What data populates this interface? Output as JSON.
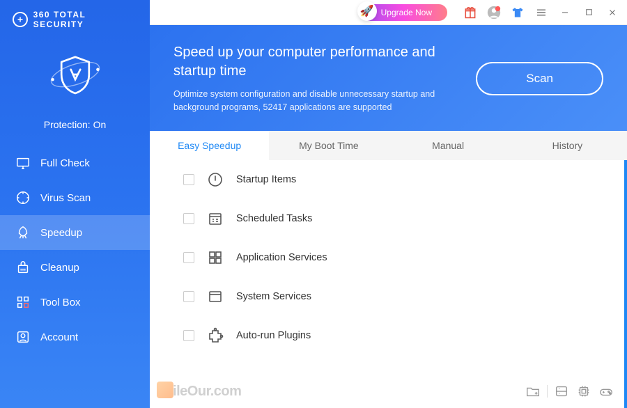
{
  "app": {
    "name": "360 TOTAL SECURITY",
    "protection_label": "Protection: On"
  },
  "titlebar": {
    "upgrade_label": "Upgrade Now"
  },
  "sidebar": {
    "items": [
      {
        "label": "Full Check"
      },
      {
        "label": "Virus Scan"
      },
      {
        "label": "Speedup"
      },
      {
        "label": "Cleanup"
      },
      {
        "label": "Tool Box"
      },
      {
        "label": "Account"
      }
    ]
  },
  "hero": {
    "title": "Speed up your computer performance and startup time",
    "subtitle": "Optimize system configuration and disable unnecessary startup and background programs, 52417 applications are supported",
    "scan_label": "Scan"
  },
  "tabs": [
    {
      "label": "Easy Speedup",
      "active": true
    },
    {
      "label": "My Boot Time"
    },
    {
      "label": "Manual"
    },
    {
      "label": "History"
    }
  ],
  "categories": [
    {
      "label": "Startup Items",
      "icon": "power-icon"
    },
    {
      "label": "Scheduled Tasks",
      "icon": "calendar-icon"
    },
    {
      "label": "Application Services",
      "icon": "grid-icon"
    },
    {
      "label": "System Services",
      "icon": "window-icon"
    },
    {
      "label": "Auto-run Plugins",
      "icon": "plugin-icon"
    }
  ],
  "watermark": "ileOur.com"
}
